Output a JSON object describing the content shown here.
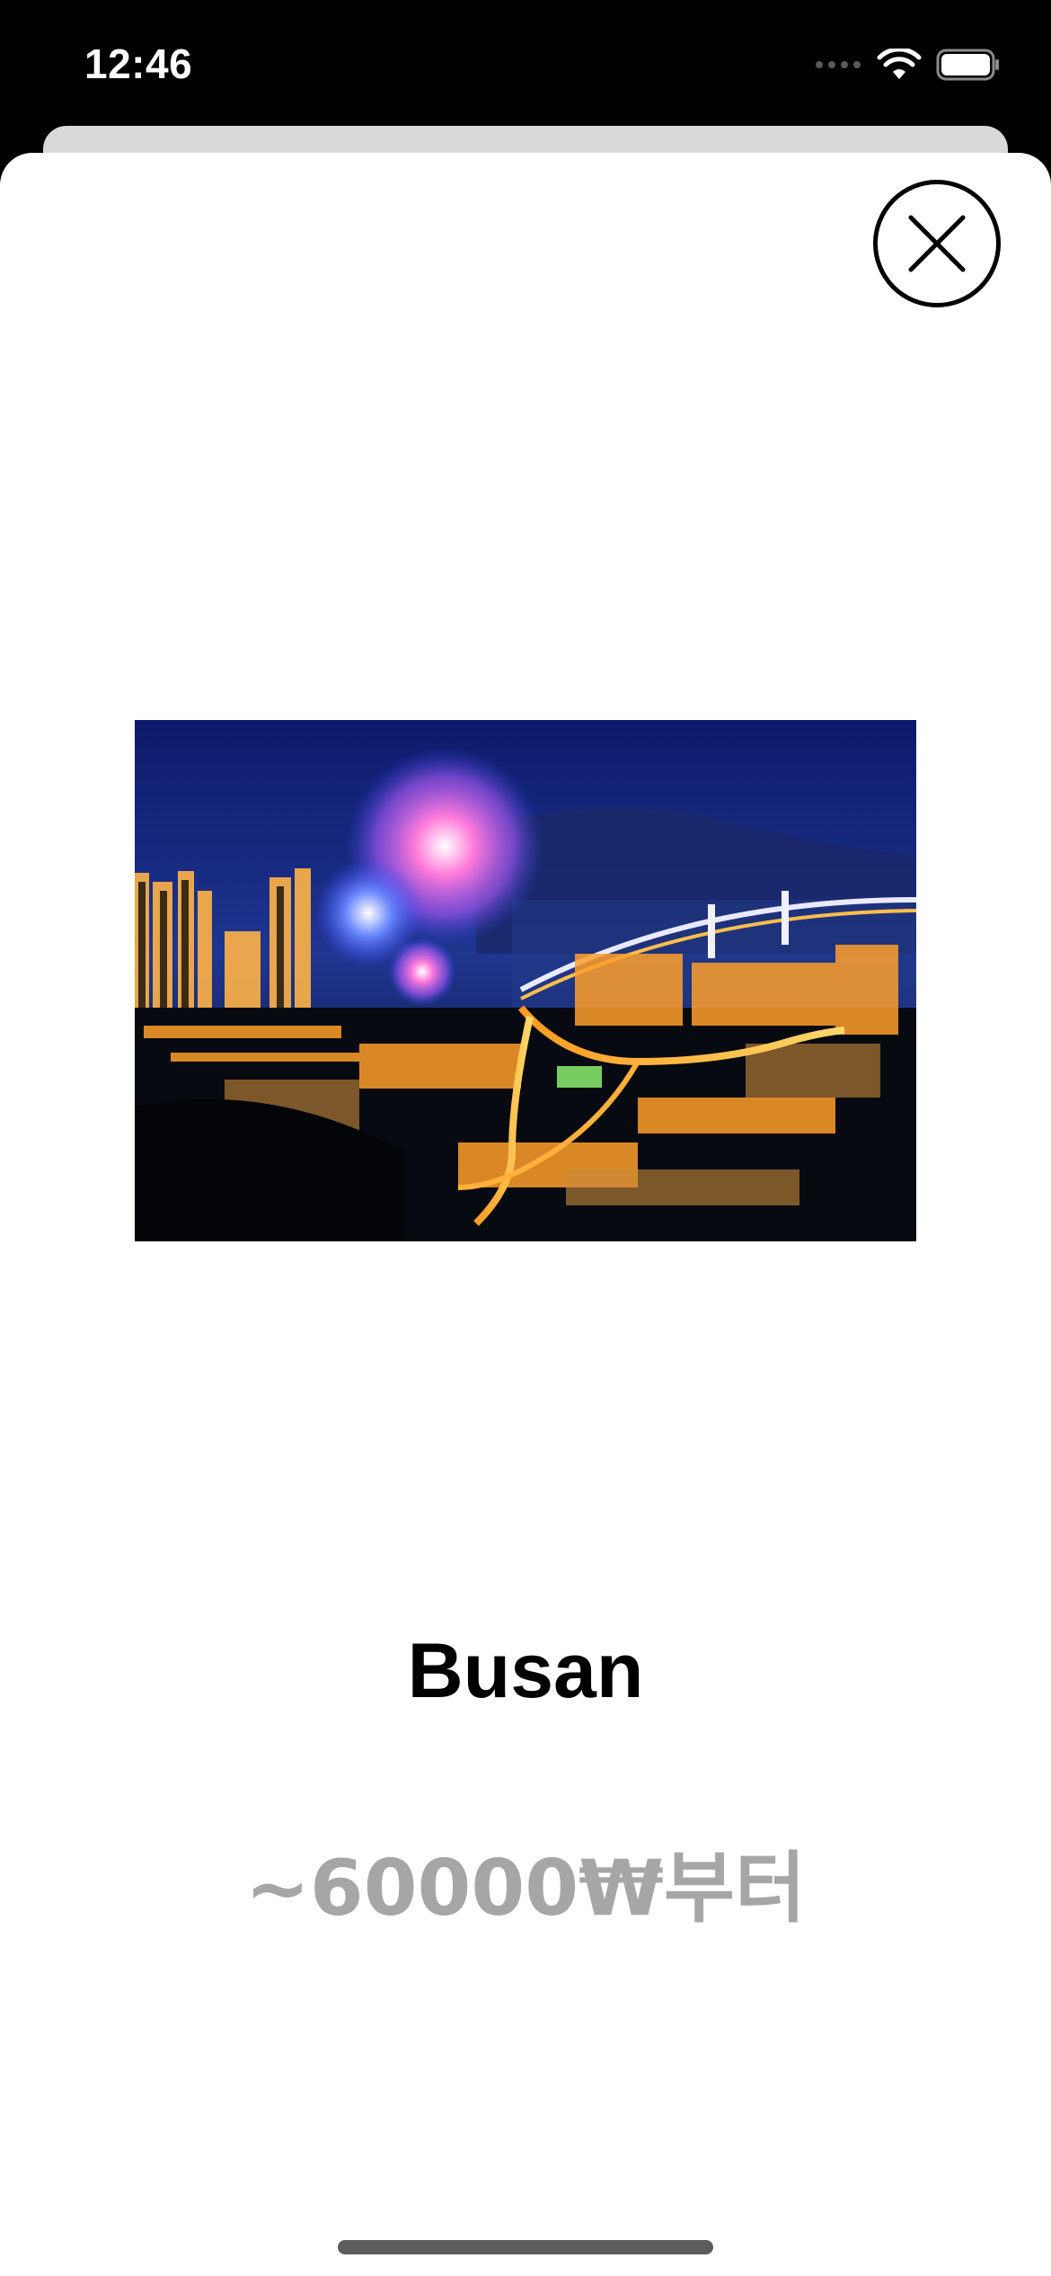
{
  "status_bar": {
    "time": "12:46"
  },
  "sheet": {
    "close_icon": "close-icon",
    "image_alt": "Busan night skyline with fireworks and bridge",
    "title": "Busan",
    "price": "~60000₩부터"
  },
  "colors": {
    "background": "#ffffff",
    "title": "#000000",
    "price": "#a6a6a6",
    "status_bar": "#000000"
  }
}
